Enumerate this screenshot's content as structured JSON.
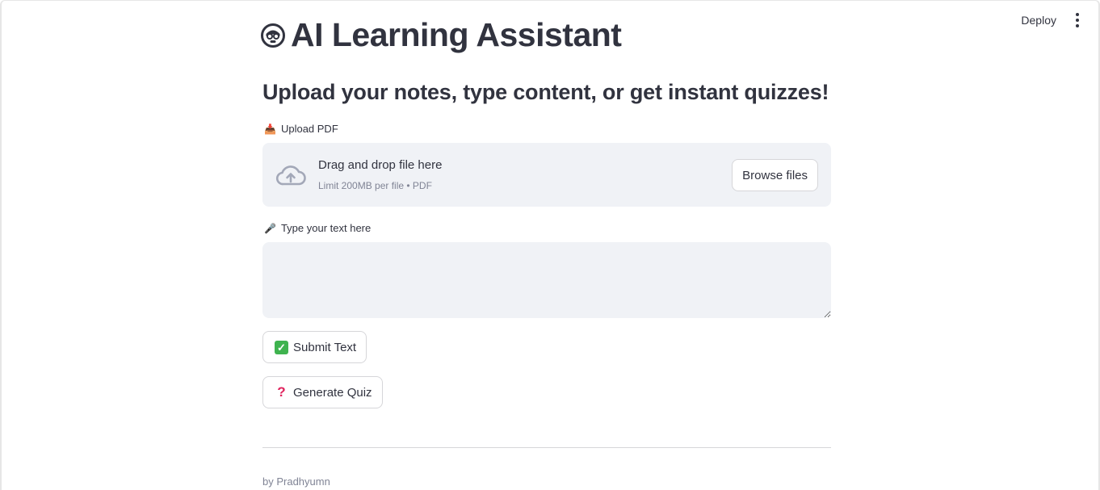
{
  "header": {
    "deploy_label": "Deploy",
    "menu_icon": "kebab-menu-icon"
  },
  "title": {
    "icon": "robot-face-icon",
    "text": "AI Learning Assistant"
  },
  "subtitle": "Upload your notes, type content, or get instant quizzes!",
  "upload": {
    "label_icon": "📥",
    "label": "Upload PDF",
    "dropzone_icon": "cloud-upload-icon",
    "drag_text": "Drag and drop file here",
    "limit_text": "Limit 200MB per file • PDF",
    "browse_label": "Browse files"
  },
  "text_input": {
    "label_icon": "🎤",
    "label": "Type your text here",
    "value": ""
  },
  "buttons": {
    "submit_label": "Submit Text",
    "submit_icon": "check-mark-icon",
    "quiz_label": "Generate Quiz",
    "quiz_icon": "question-mark-icon"
  },
  "footer": "by Pradhyumn",
  "colors": {
    "text": "#31333f",
    "muted": "#808495",
    "panel_bg": "#f0f2f6",
    "border": "#d6d6d9",
    "check_green": "#3fb34f",
    "question_red": "#e0245e"
  }
}
